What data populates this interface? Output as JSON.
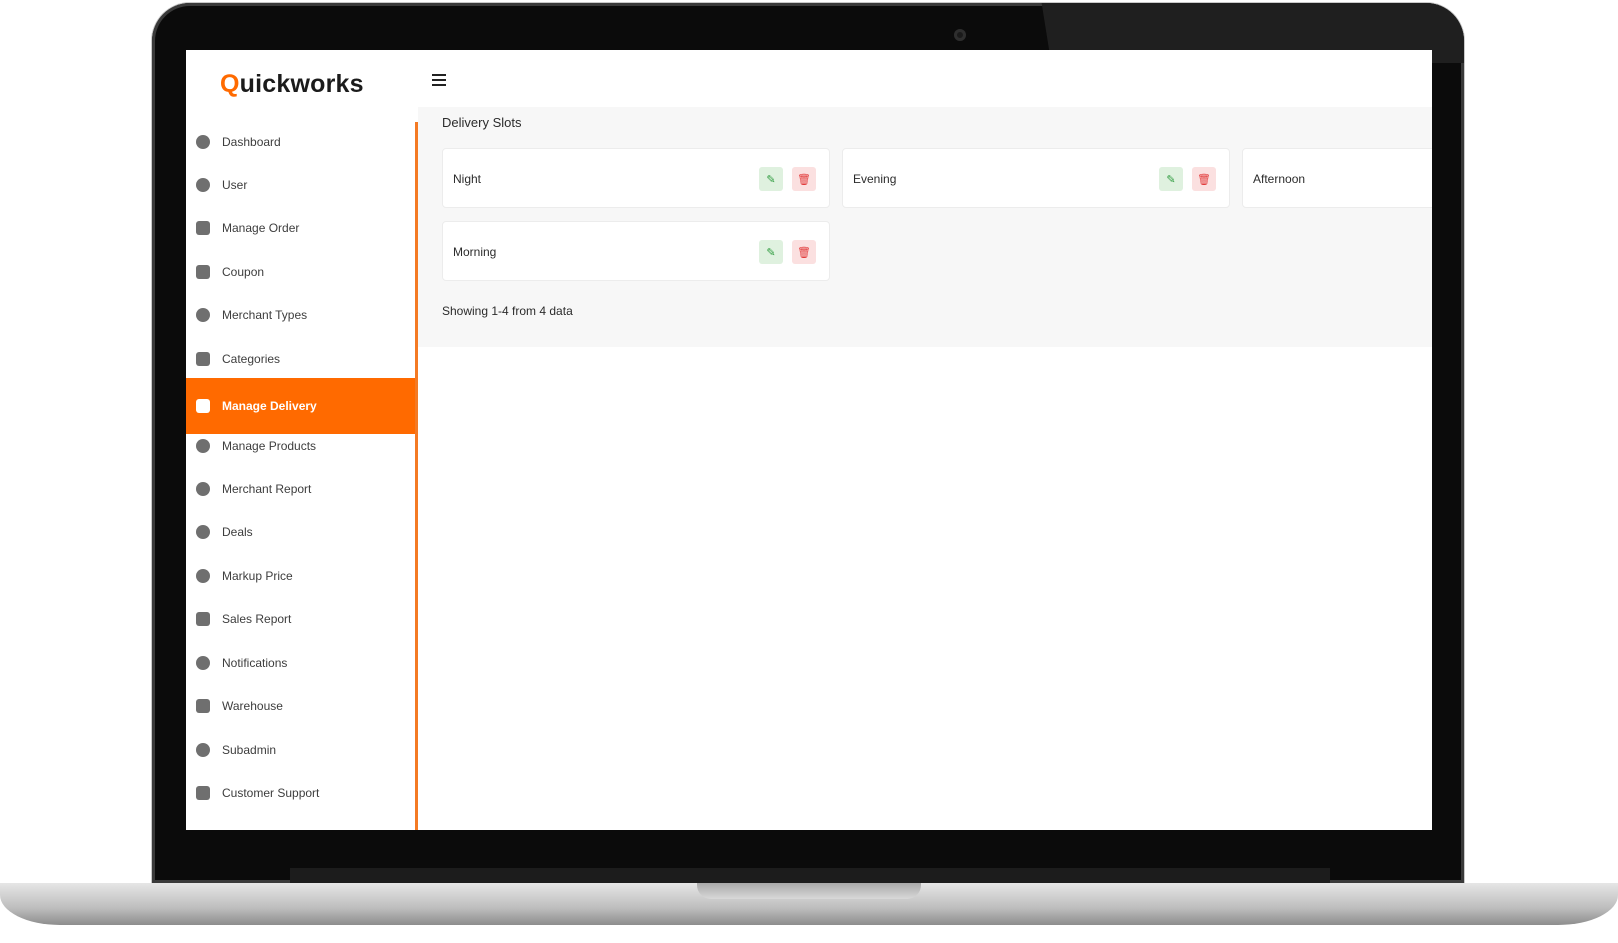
{
  "brand": {
    "logo_q": "Q",
    "logo_rest": "uickworks"
  },
  "sidebar": {
    "items": [
      {
        "label": "Dashboard",
        "icon": "dashboard-icon"
      },
      {
        "label": "User",
        "icon": "user-icon"
      },
      {
        "label": "Manage Order",
        "icon": "cart-icon"
      },
      {
        "label": "Coupon",
        "icon": "coupon-icon"
      },
      {
        "label": "Merchant Types",
        "icon": "merchant-icon"
      },
      {
        "label": "Categories",
        "icon": "categories-icon"
      },
      {
        "label": "Manage Delivery",
        "icon": "delivery-icon",
        "active": true
      },
      {
        "label": "Manage Products",
        "icon": "products-icon"
      },
      {
        "label": "Merchant Report",
        "icon": "report-icon"
      },
      {
        "label": "Deals",
        "icon": "tag-icon"
      },
      {
        "label": "Markup Price",
        "icon": "price-tag-icon"
      },
      {
        "label": "Sales Report",
        "icon": "chart-icon"
      },
      {
        "label": "Notifications",
        "icon": "bell-icon"
      },
      {
        "label": "Warehouse",
        "icon": "warehouse-icon"
      },
      {
        "label": "Subadmin",
        "icon": "subadmin-icon"
      },
      {
        "label": "Customer Support",
        "icon": "support-icon"
      }
    ]
  },
  "main": {
    "title": "Delivery Slots",
    "slots": [
      {
        "name": "Night"
      },
      {
        "name": "Evening"
      },
      {
        "name": "Afternoon"
      },
      {
        "name": "Morning"
      }
    ],
    "pagination_text": "Showing 1-4 from 4 data"
  },
  "colors": {
    "accent": "#ff6a00",
    "edit": "#2e9b3e",
    "delete": "#e23b3b"
  }
}
